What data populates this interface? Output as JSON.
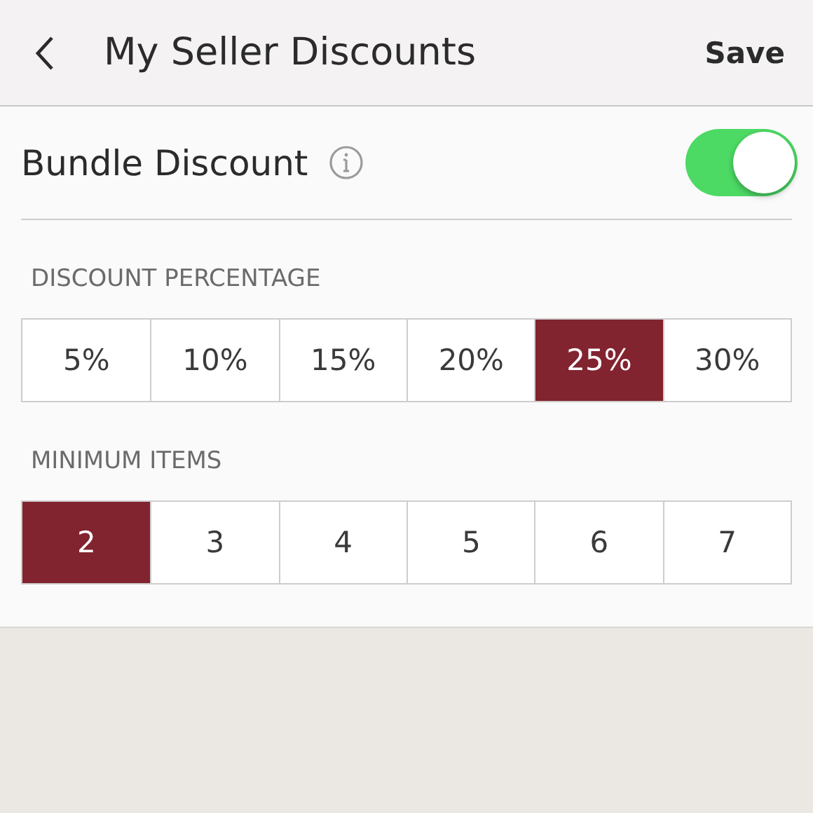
{
  "header": {
    "title": "My Seller Discounts",
    "action": "Save"
  },
  "bundle": {
    "label": "Bundle Discount",
    "on": true
  },
  "sections": [
    {
      "label": "DISCOUNT PERCENTAGE",
      "options": [
        {
          "label": "5%",
          "selected": false
        },
        {
          "label": "10%",
          "selected": false
        },
        {
          "label": "15%",
          "selected": false
        },
        {
          "label": "20%",
          "selected": false
        },
        {
          "label": "25%",
          "selected": true
        },
        {
          "label": "30%",
          "selected": false
        }
      ]
    },
    {
      "label": "MINIMUM ITEMS",
      "options": [
        {
          "label": "2",
          "selected": true
        },
        {
          "label": "3",
          "selected": false
        },
        {
          "label": "4",
          "selected": false
        },
        {
          "label": "5",
          "selected": false
        },
        {
          "label": "6",
          "selected": false
        },
        {
          "label": "7",
          "selected": false
        }
      ]
    }
  ]
}
